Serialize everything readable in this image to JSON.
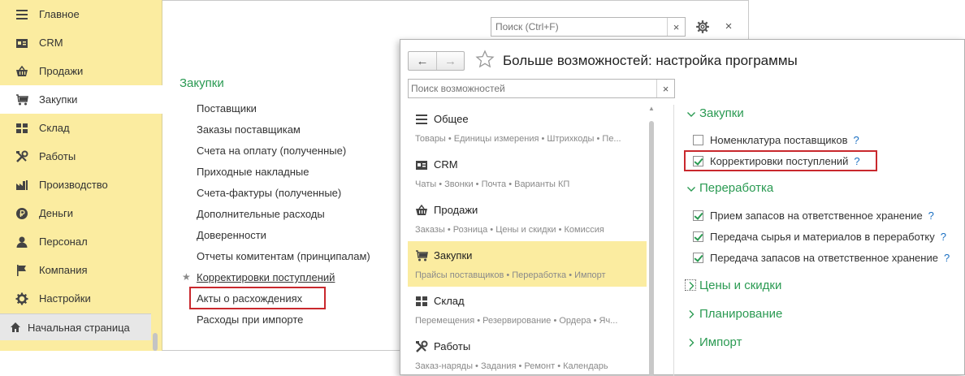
{
  "sidebar": {
    "items": [
      {
        "label": "Главное",
        "icon": "menu-icon"
      },
      {
        "label": "CRM",
        "icon": "contact-card-icon"
      },
      {
        "label": "Продажи",
        "icon": "basket-icon"
      },
      {
        "label": "Закупки",
        "icon": "cart-icon"
      },
      {
        "label": "Склад",
        "icon": "warehouse-grid-icon"
      },
      {
        "label": "Работы",
        "icon": "tools-icon"
      },
      {
        "label": "Производство",
        "icon": "factory-icon"
      },
      {
        "label": "Деньги",
        "icon": "ruble-coin-icon"
      },
      {
        "label": "Персонал",
        "icon": "person-icon"
      },
      {
        "label": "Компания",
        "icon": "flag-icon"
      },
      {
        "label": "Настройки",
        "icon": "gear-icon"
      }
    ],
    "active_index": 3,
    "home": {
      "label": "Начальная страница",
      "icon": "home-icon"
    }
  },
  "bg_window": {
    "search_placeholder": "Поиск (Ctrl+F)",
    "clear_glyph": "×",
    "close_glyph": "×",
    "section_title": "Закупки",
    "links": [
      "Поставщики",
      "Заказы поставщикам",
      "Счета на оплату (полученные)",
      "Приходные накладные",
      "Счета-фактуры (полученные)",
      "Дополнительные расходы",
      "Доверенности",
      "Отчеты комитентам (принципалам)",
      "Корректировки поступлений",
      "Акты о расхождениях",
      "Расходы при импорте"
    ]
  },
  "dialog": {
    "back_glyph": "←",
    "forward_glyph": "→",
    "title": "Больше возможностей: настройка программы",
    "search_placeholder": "Поиск возможностей",
    "clear_glyph": "×",
    "categories": [
      {
        "label": "Общее",
        "desc": "Товары • Единицы измерения • Штрихкоды • Пе...",
        "icon": "menu-icon"
      },
      {
        "label": "CRM",
        "desc": "Чаты • Звонки • Почта • Варианты КП",
        "icon": "contact-card-icon"
      },
      {
        "label": "Продажи",
        "desc": "Заказы • Розница • Цены и скидки • Комиссия",
        "icon": "basket-icon"
      },
      {
        "label": "Закупки",
        "desc": "Прайсы поставщиков • Переработка • Импорт",
        "icon": "cart-icon"
      },
      {
        "label": "Склад",
        "desc": "Перемещения • Резервирование • Ордера • Яч...",
        "icon": "warehouse-grid-icon"
      },
      {
        "label": "Работы",
        "desc": "Заказ-наряды • Задания • Ремонт • Календарь",
        "icon": "tools-icon"
      }
    ],
    "active_category": 3,
    "groups": [
      {
        "title": "Закупки",
        "expanded": true,
        "options": [
          {
            "label": "Номенклатура поставщиков",
            "checked": false
          },
          {
            "label": "Корректировки поступлений",
            "checked": true
          }
        ]
      },
      {
        "title": "Переработка",
        "expanded": true,
        "options": [
          {
            "label": "Прием запасов на ответственное хранение",
            "checked": true
          },
          {
            "label": "Передача сырья и материалов в переработку",
            "checked": true
          },
          {
            "label": "Передача запасов на ответственное хранение",
            "checked": true
          }
        ]
      },
      {
        "title": "Цены и скидки",
        "expanded": false
      },
      {
        "title": "Планирование",
        "expanded": false
      },
      {
        "title": "Импорт",
        "expanded": false
      }
    ],
    "help_glyph": "?"
  },
  "colors": {
    "sidebar_bg": "#fbeca0",
    "accent_green": "#2a9a52",
    "highlight_red": "#c9282d",
    "link_blue": "#1a6fc2"
  }
}
